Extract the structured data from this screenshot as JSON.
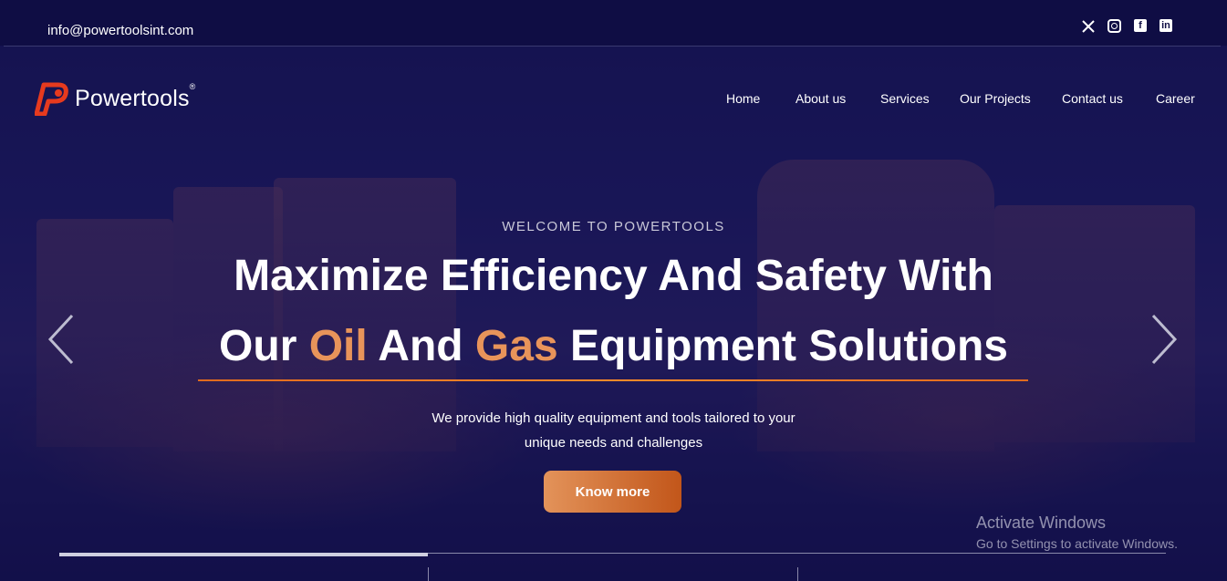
{
  "topbar": {
    "email": "info@powertoolsint.com",
    "social": [
      {
        "name": "x-icon",
        "glyph": "𝕏"
      },
      {
        "name": "instagram-icon",
        "glyph": ""
      },
      {
        "name": "facebook-icon",
        "glyph": "f"
      },
      {
        "name": "linkedin-icon",
        "glyph": "in"
      }
    ]
  },
  "header": {
    "logo_text": "Powertools",
    "logo_reg": "®",
    "nav": [
      "Home",
      "About us",
      "Services",
      "Our Projects",
      "Contact us",
      "Career"
    ]
  },
  "hero": {
    "eyebrow": "WELCOME TO POWERTOOLS",
    "headline_line1": "Maximize Efficiency And Safety With",
    "headline_line2": {
      "part1": "Our ",
      "accent1": "Oil",
      "part2": " And ",
      "accent2": "Gas",
      "part3": " Equipment Solutions"
    },
    "subtitle_line1": "We provide high quality equipment and tools tailored to your",
    "subtitle_line2": "unique needs and challenges",
    "cta_label": "Know more",
    "prev_icon": "chevron-left-icon",
    "next_icon": "chevron-right-icon"
  },
  "slider": {
    "slide_count": 3,
    "active_progress": 0.33
  },
  "watermark": {
    "title": "Activate Windows",
    "subtitle": "Go to Settings to activate Windows."
  },
  "colors": {
    "background": "#12114a",
    "accent": "#e8945a",
    "cta_start": "#e3935a",
    "cta_end": "#c2561a",
    "logo_red": "#e63a1e"
  }
}
